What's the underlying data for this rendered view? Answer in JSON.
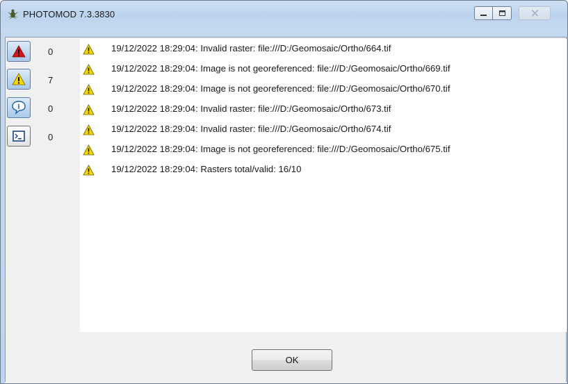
{
  "window": {
    "title": "PHOTOMOD 7.3.3830",
    "controls": {
      "minimize": "minimize-icon",
      "maximize": "maximize-icon",
      "close": "close-icon"
    }
  },
  "filters": [
    {
      "name": "errors",
      "icon": "error-icon",
      "count": "0",
      "active": true
    },
    {
      "name": "warnings",
      "icon": "warning-icon",
      "count": "7",
      "active": true
    },
    {
      "name": "info",
      "icon": "info-icon",
      "count": "0",
      "active": true
    },
    {
      "name": "console",
      "icon": "console-icon",
      "count": "0",
      "active": false
    }
  ],
  "messages": [
    {
      "icon": "warning-icon",
      "text": "19/12/2022 18:29:04: Invalid raster: file:///D:/Geomosaic/Ortho/664.tif"
    },
    {
      "icon": "warning-icon",
      "text": "19/12/2022 18:29:04: Image is not georeferenced: file:///D:/Geomosaic/Ortho/669.tif"
    },
    {
      "icon": "warning-icon",
      "text": "19/12/2022 18:29:04: Image is not georeferenced: file:///D:/Geomosaic/Ortho/670.tif"
    },
    {
      "icon": "warning-icon",
      "text": "19/12/2022 18:29:04: Invalid raster: file:///D:/Geomosaic/Ortho/673.tif"
    },
    {
      "icon": "warning-icon",
      "text": "19/12/2022 18:29:04: Invalid raster: file:///D:/Geomosaic/Ortho/674.tif"
    },
    {
      "icon": "warning-icon",
      "text": "19/12/2022 18:29:04: Image is not georeferenced: file:///D:/Geomosaic/Ortho/675.tif"
    },
    {
      "icon": "warning-icon",
      "text": "19/12/2022 18:29:04: Rasters total/valid: 16/10"
    }
  ],
  "footer": {
    "ok_label": "OK"
  },
  "colors": {
    "titlebar": "#c4d8f0",
    "warning_yellow": "#f5d800",
    "error_red": "#d21616",
    "accent_blue": "#a9c8e9"
  }
}
